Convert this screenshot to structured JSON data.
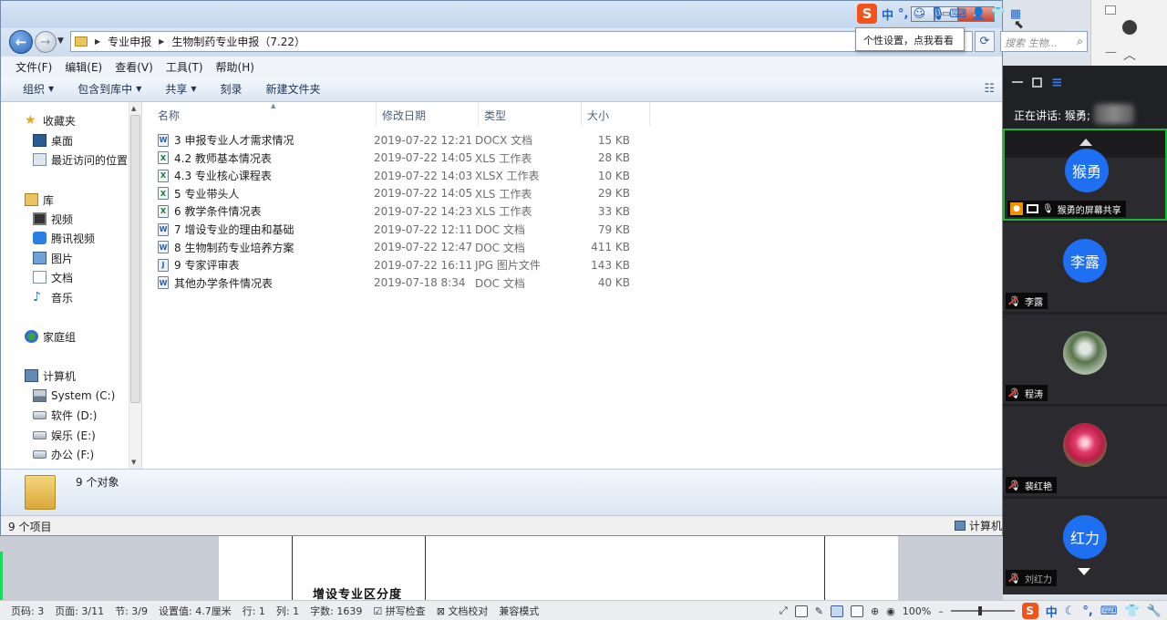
{
  "window": {
    "search_placeholder": "搜索 生物...",
    "minimize": "–",
    "restore": "▭",
    "close": "✕"
  },
  "breadcrumb": [
    "专业申报",
    "生物制药专业申报（7.22）"
  ],
  "menubar": [
    "文件(F)",
    "编辑(E)",
    "查看(V)",
    "工具(T)",
    "帮助(H)"
  ],
  "toolbar": {
    "organize": "组织",
    "include_in_library": "包含到库中",
    "share": "共享",
    "burn": "刻录",
    "new_folder": "新建文件夹"
  },
  "navpane": {
    "favorites": "收藏夹",
    "desktop": "桌面",
    "recent": "最近访问的位置",
    "libraries": "库",
    "videos": "视频",
    "tencent_video": "腾讯视频",
    "pictures": "图片",
    "documents": "文档",
    "music": "音乐",
    "homegroup": "家庭组",
    "computer": "计算机",
    "drive_c": "System (C:)",
    "drive_d": "软件 (D:)",
    "drive_e": "娱乐 (E:)",
    "drive_f": "办公 (F:)"
  },
  "columns": {
    "name": "名称",
    "date": "修改日期",
    "type": "类型",
    "size": "大小"
  },
  "files": [
    {
      "name": "3 申报专业人才需求情况",
      "date": "2019-07-22 12:21",
      "type": "DOCX 文档",
      "size": "15 KB",
      "kind": "word"
    },
    {
      "name": "4.2 教师基本情况表",
      "date": "2019-07-22 14:05",
      "type": "XLS 工作表",
      "size": "28 KB",
      "kind": "excel"
    },
    {
      "name": "4.3 专业核心课程表",
      "date": "2019-07-22 14:03",
      "type": "XLSX 工作表",
      "size": "10 KB",
      "kind": "excel"
    },
    {
      "name": "5 专业带头人",
      "date": "2019-07-22 14:05",
      "type": "XLS 工作表",
      "size": "29 KB",
      "kind": "excel"
    },
    {
      "name": "6 教学条件情况表",
      "date": "2019-07-22 14:23",
      "type": "XLS 工作表",
      "size": "33 KB",
      "kind": "excel"
    },
    {
      "name": "7 增设专业的理由和基础",
      "date": "2019-07-22 12:11",
      "type": "DOC 文档",
      "size": "79 KB",
      "kind": "word"
    },
    {
      "name": "8 生物制药专业培养方案",
      "date": "2019-07-22 12:47",
      "type": "DOC 文档",
      "size": "411 KB",
      "kind": "word"
    },
    {
      "name": "9 专家评审表",
      "date": "2019-07-22 16:11",
      "type": "JPG 图片文件",
      "size": "143 KB",
      "kind": "jpg"
    },
    {
      "name": "其他办学条件情况表",
      "date": "2019-07-18 8:34",
      "type": "DOC 文档",
      "size": "40 KB",
      "kind": "word"
    }
  ],
  "details": {
    "object_count": "9 个对象"
  },
  "statusbar": {
    "items": "9 个项目",
    "computer": "计算机"
  },
  "ime": {
    "logo": "S",
    "mode": "中",
    "punct": "°,",
    "tooltip": "个性设置，点我看看"
  },
  "meeting": {
    "speaking_label": "正在讲话: 猴勇;",
    "participants": [
      {
        "avatar_text": "猴勇",
        "label": "猴勇的屏幕共享",
        "active": true
      },
      {
        "avatar_text": "李露",
        "label": "李露"
      },
      {
        "avatar_text": "",
        "label": "程涛"
      },
      {
        "avatar_text": "",
        "label": "裴红艳"
      },
      {
        "avatar_text": "红力",
        "label": "刘红力"
      }
    ]
  },
  "document": {
    "heading_fragment": "增设专业区分度"
  },
  "wordbar": {
    "page_no": "页码: 3",
    "pages": "页面: 3/11",
    "section": "节: 3/9",
    "setting": "设置值: 4.7厘米",
    "row": "行: 1",
    "col": "列: 1",
    "word_count": "字数: 1639",
    "spell_check": "拼写检查",
    "doc_proof": "文档校对",
    "compat_mode": "兼容模式",
    "zoom": "100%"
  }
}
